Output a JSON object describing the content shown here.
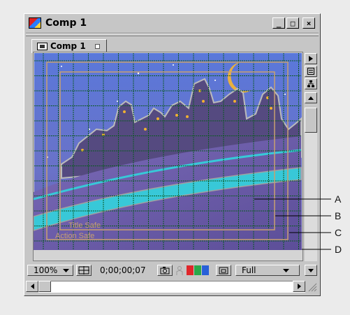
{
  "window": {
    "title": "Comp 1",
    "controls": {
      "minimize": "_",
      "maximize": "□",
      "close": "×"
    }
  },
  "tab": {
    "label": "Comp 1"
  },
  "viewer": {
    "title_safe_label": "Title Safe",
    "action_safe_label": "Action Safe"
  },
  "bottom_bar": {
    "zoom": "100%",
    "timecode": "0;00;00;07",
    "resolution": "Full"
  },
  "callouts": [
    "A",
    "B",
    "C",
    "D"
  ],
  "colors": {
    "grid": "#0a5a22",
    "title_safe": "#c8a070",
    "action_safe": "#c8a070",
    "sky_top": "#5878d8",
    "sky_bottom": "#7064b0",
    "river": "#38c8d8",
    "moon": "#e8b040"
  },
  "icons": {
    "app": "comp-window-icon",
    "tab": "composition-icon",
    "side_menu": "triangle-right-icon",
    "side_1": "comp-flowchart-icon",
    "side_2": "tree-icon",
    "scroll_up": "arrow-up-icon",
    "scroll_down": "arrow-down-icon",
    "scroll_left": "arrow-left-icon",
    "scroll_right": "arrow-right-icon",
    "safe_zones": "safe-zones-icon",
    "snapshot": "camera-icon",
    "show_snapshot": "person-icon",
    "channels": "rgb-channels-icon",
    "region": "region-of-interest-icon"
  }
}
